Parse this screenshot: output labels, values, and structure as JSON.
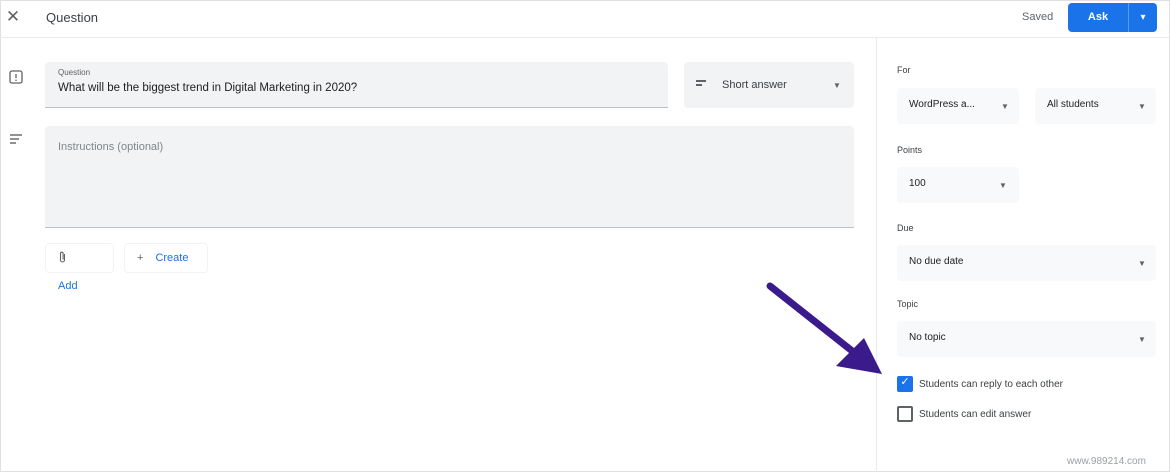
{
  "header": {
    "title": "Question",
    "saved_status": "Saved",
    "ask_label": "Ask",
    "close_glyph": "✕",
    "menu_glyph": "▾"
  },
  "main": {
    "question": {
      "label": "Question",
      "value": "What will be the biggest trend in Digital Marketing in 2020?"
    },
    "type_select": {
      "value": "Short answer",
      "icon": "short-answer-icon"
    },
    "instructions": {
      "placeholder": "Instructions (optional)"
    },
    "chips": [
      {
        "label": "Add",
        "icon": "paperclip-icon",
        "glyph": "📎"
      },
      {
        "label": "Create",
        "icon": "plus-icon",
        "glyph": "+"
      }
    ]
  },
  "right_panel": {
    "for": {
      "label": "For",
      "class_value": "WordPress a...",
      "students_value": "All students"
    },
    "points": {
      "label": "Points",
      "value": "100"
    },
    "due": {
      "label": "Due",
      "value": "No due date"
    },
    "topic": {
      "label": "Topic",
      "value": "No topic"
    },
    "options": [
      {
        "label": "Students can reply to each other",
        "checked": true
      },
      {
        "label": "Students can edit answer",
        "checked": false
      }
    ]
  },
  "colors": {
    "accent": "#1a73e8",
    "arrow": "#3b1a8c"
  },
  "watermark": "www.989214.com"
}
